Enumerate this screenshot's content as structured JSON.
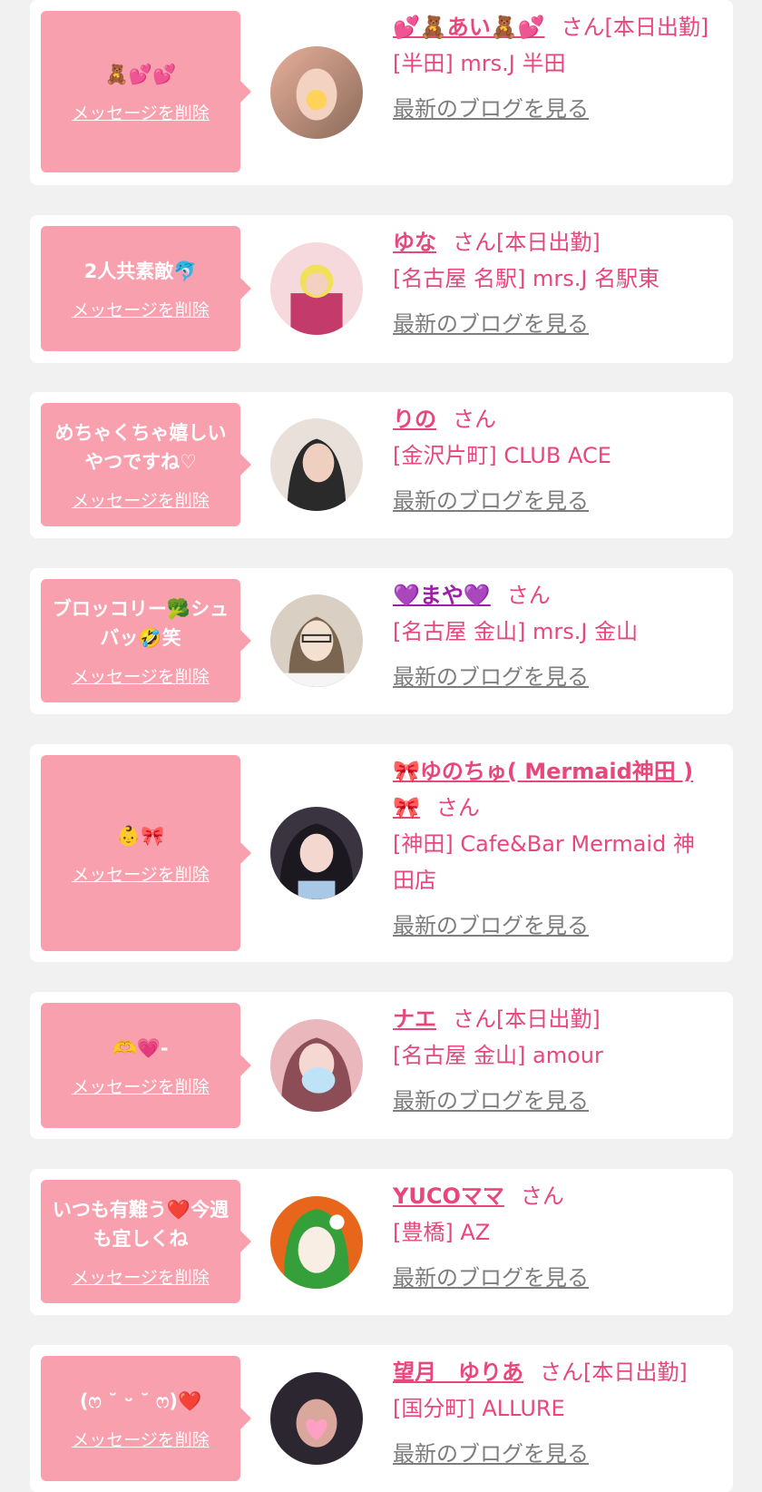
{
  "items": [
    {
      "bubble": "🧸💕💕",
      "delete": "メッセージを削除",
      "name": "💕🧸あい🧸💕",
      "suffix": "さん[本日出勤]",
      "shop": "[半田] mrs.J 半田",
      "blog": "最新のブログを見る",
      "avatar": {
        "bg1": "#d8a28a",
        "bg2": "#8a6a5a",
        "accent": "#ffd35a"
      }
    },
    {
      "bubble": "2人共素敵🐬",
      "delete": "メッセージを削除",
      "name": "ゆな",
      "suffix": "さん[本日出勤]",
      "shop": "[名古屋 名駅] mrs.J 名駅東",
      "blog": "最新のブログを見る",
      "avatar": {
        "bg1": "#f6d9dc",
        "bg2": "#c43a6a",
        "accent": "#f0e05a"
      }
    },
    {
      "bubble": "めちゃくちゃ嬉しいやつですね♡",
      "delete": "メッセージを削除",
      "name": "りの",
      "suffix": "さん",
      "shop": "[金沢片町] CLUB ACE",
      "blog": "最新のブログを見る",
      "avatar": {
        "bg1": "#e9e1d9",
        "bg2": "#2a2a2a",
        "accent": "#e8c6b0"
      }
    },
    {
      "bubble": "ブロッコリー🥦シュバッ🤣笑",
      "delete": "メッセージを削除",
      "name": "💜まや💜",
      "suffix": "さん",
      "shop": "[名古屋 金山] mrs.J 金山",
      "blog": "最新のブログを見る",
      "avatar": {
        "bg1": "#d9cfc2",
        "bg2": "#7a6550",
        "accent": "#f2e0d0"
      }
    },
    {
      "bubble": "👶🎀",
      "delete": "メッセージを削除",
      "name": "🎀ゆのちゅ( Mermaid神田 )🎀",
      "suffix": "さん",
      "shop": "[神田] Cafe&Bar Mermaid 神田店",
      "blog": "最新のブログを見る",
      "avatar": {
        "bg1": "#3a3340",
        "bg2": "#1b1820",
        "accent": "#f4d8d0"
      }
    },
    {
      "bubble": "🫶💗-",
      "delete": "メッセージを削除",
      "name": "ナエ",
      "suffix": "さん[本日出勤]",
      "shop": "[名古屋 金山] amour",
      "blog": "最新のブログを見る",
      "avatar": {
        "bg1": "#e9b7bc",
        "bg2": "#8c4d56",
        "accent": "#bfe3f6"
      }
    },
    {
      "bubble": "いつも有難う❤️今週も宜しくね",
      "delete": "メッセージを削除",
      "name": "YUCOママ",
      "suffix": "さん",
      "shop": "[豊橋] AZ",
      "blog": "最新のブログを見る",
      "avatar": {
        "bg1": "#e7661c",
        "bg2": "#35a03a",
        "accent": "#ffffff"
      }
    },
    {
      "bubble": "(ෆ ˘ ᵕ ˘ ෆ)❤️",
      "delete": "メッセージを削除",
      "name": "望月　ゆりあ",
      "suffix": "さん[本日出勤]",
      "shop": "[国分町] ALLURE",
      "blog": "最新のブログを見る",
      "avatar": {
        "bg1": "#2b2630",
        "bg2": "#d9a79b",
        "accent": "#ff9fc4"
      }
    }
  ]
}
